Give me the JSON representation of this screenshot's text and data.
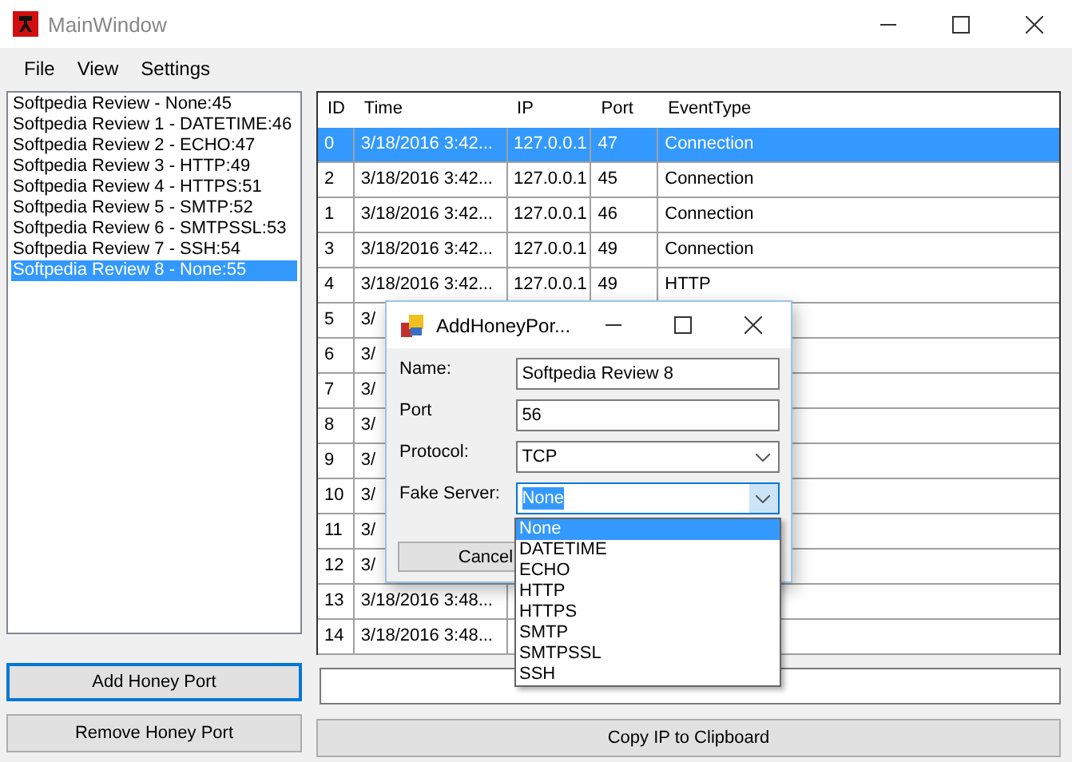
{
  "window": {
    "title": "MainWindow"
  },
  "menu": [
    "File",
    "View",
    "Settings"
  ],
  "ports": [
    {
      "label": "Softpedia Review - None:45",
      "selected": false
    },
    {
      "label": "Softpedia Review 1 - DATETIME:46",
      "selected": false
    },
    {
      "label": "Softpedia Review 2 - ECHO:47",
      "selected": false
    },
    {
      "label": "Softpedia Review 3 - HTTP:49",
      "selected": false
    },
    {
      "label": "Softpedia Review 4 - HTTPS:51",
      "selected": false
    },
    {
      "label": "Softpedia Review 5 - SMTP:52",
      "selected": false
    },
    {
      "label": "Softpedia Review 6 - SMTPSSL:53",
      "selected": false
    },
    {
      "label": "Softpedia Review 7 - SSH:54",
      "selected": false
    },
    {
      "label": "Softpedia Review 8 - None:55",
      "selected": true
    }
  ],
  "table": {
    "columns": [
      "ID",
      "Time",
      "IP",
      "Port",
      "EventType"
    ],
    "rows": [
      {
        "id": "0",
        "time": "3/18/2016 3:42...",
        "ip": "127.0.0.1",
        "port": "47",
        "event_type": "Connection",
        "selected": true
      },
      {
        "id": "2",
        "time": "3/18/2016 3:42...",
        "ip": "127.0.0.1",
        "port": "45",
        "event_type": "Connection",
        "selected": false
      },
      {
        "id": "1",
        "time": "3/18/2016 3:42...",
        "ip": "127.0.0.1",
        "port": "46",
        "event_type": "Connection",
        "selected": false
      },
      {
        "id": "3",
        "time": "3/18/2016 3:42...",
        "ip": "127.0.0.1",
        "port": "49",
        "event_type": "Connection",
        "selected": false
      },
      {
        "id": "4",
        "time": "3/18/2016 3:42...",
        "ip": "127.0.0.1",
        "port": "49",
        "event_type": "HTTP",
        "selected": false
      },
      {
        "id": "5",
        "time": "3/",
        "selected": false
      },
      {
        "id": "6",
        "time": "3/",
        "selected": false
      },
      {
        "id": "7",
        "time": "3/",
        "selected": false
      },
      {
        "id": "8",
        "time": "3/",
        "selected": false
      },
      {
        "id": "9",
        "time": "3/",
        "selected": false
      },
      {
        "id": "10",
        "time": "3/",
        "selected": false
      },
      {
        "id": "11",
        "time": "3/",
        "selected": false
      },
      {
        "id": "12",
        "time": "3/",
        "selected": false
      },
      {
        "id": "13",
        "time": "3/18/2016 3:48...",
        "selected": false
      },
      {
        "id": "14",
        "time": "3/18/2016 3:48...",
        "selected": false
      }
    ]
  },
  "buttons": {
    "add": "Add Honey Port",
    "remove": "Remove Honey Port",
    "copy": "Copy IP to Clipboard"
  },
  "dialog": {
    "title": "AddHoneyPor...",
    "name": {
      "label": "Name:",
      "value": "Softpedia Review 8"
    },
    "port": {
      "label": "Port",
      "value": "56"
    },
    "protocol": {
      "label": "Protocol:",
      "value": "TCP"
    },
    "fake_server": {
      "label": "Fake Server:",
      "value": "None",
      "expanded": true,
      "options": [
        {
          "label": "None",
          "selected": true
        },
        {
          "label": "DATETIME",
          "selected": false
        },
        {
          "label": "ECHO",
          "selected": false
        },
        {
          "label": "HTTP",
          "selected": false
        },
        {
          "label": "HTTPS",
          "selected": false
        },
        {
          "label": "SMTP",
          "selected": false
        },
        {
          "label": "SMTPSSL",
          "selected": false
        },
        {
          "label": "SSH",
          "selected": false
        }
      ]
    },
    "cancel": "Cancel"
  }
}
